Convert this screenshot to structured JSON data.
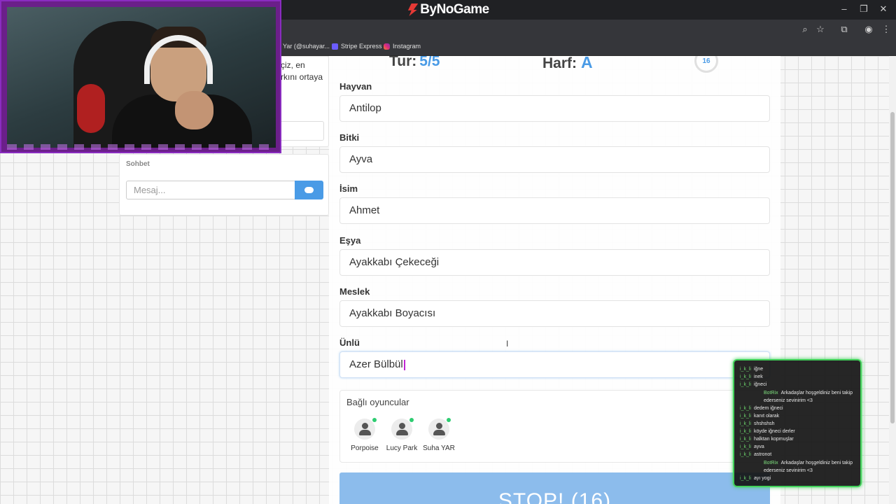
{
  "browser": {
    "brand": "ByNoGame",
    "bookmarks": [
      "Yar (@suhayar...",
      "Stripe Express",
      "Instagram"
    ]
  },
  "left_card": {
    "text_lines": [
      "çiz, en",
      "rkını ortaya"
    ]
  },
  "chat": {
    "title": "Sohbet",
    "placeholder": "Mesaj..."
  },
  "game": {
    "tur_label": "Tur:",
    "tur_value": "5/5",
    "harf_label": "Harf:",
    "harf_value": "A",
    "timer": "16",
    "fields": [
      {
        "label": "Hayvan",
        "value": "Antilop"
      },
      {
        "label": "Bitki",
        "value": "Ayva"
      },
      {
        "label": "İsim",
        "value": "Ahmet"
      },
      {
        "label": "Eşya",
        "value": "Ayakkabı Çekeceği"
      },
      {
        "label": "Meslek",
        "value": "Ayakkabı Boyacısı"
      },
      {
        "label": "Ünlü",
        "value": "Azer Bülbül"
      }
    ],
    "players_title": "Bağlı oyuncular",
    "players": [
      "Porpoise",
      "Lucy Park",
      "Suha YAR"
    ],
    "stop_label": "STOP! (16)"
  },
  "stream_chat": {
    "messages": [
      {
        "user": "i_k_li",
        "text": "iğne"
      },
      {
        "user": "i_k_li",
        "text": "inek"
      },
      {
        "user": "i_k_li",
        "text": "iğneci"
      },
      {
        "user": "BotRix",
        "text": "Arkadaşlar hoşgeldiniz beni takip ederseniz sevinirim <3",
        "bot": true
      },
      {
        "user": "i_k_li",
        "text": "dedem iğneci"
      },
      {
        "user": "i_k_li",
        "text": "kanıt olarak"
      },
      {
        "user": "i_k_li",
        "text": "shshshsh"
      },
      {
        "user": "i_k_li",
        "text": "köyde iğneci derler"
      },
      {
        "user": "i_k_li",
        "text": "halktan kopmuşlar"
      },
      {
        "user": "i_k_li",
        "text": "ayva"
      },
      {
        "user": "i_k_li",
        "text": "astronot"
      },
      {
        "user": "BotRix",
        "text": "Arkadaşlar hoşgeldiniz beni takip ederseniz sevinirim <3",
        "bot": true
      },
      {
        "user": "i_k_li",
        "text": "ayı yogi"
      }
    ]
  },
  "colors": {
    "accent": "#4a9be6",
    "stop_button": "#8cbcec",
    "online": "#2ecc71",
    "stream_border": "#41d15a"
  }
}
